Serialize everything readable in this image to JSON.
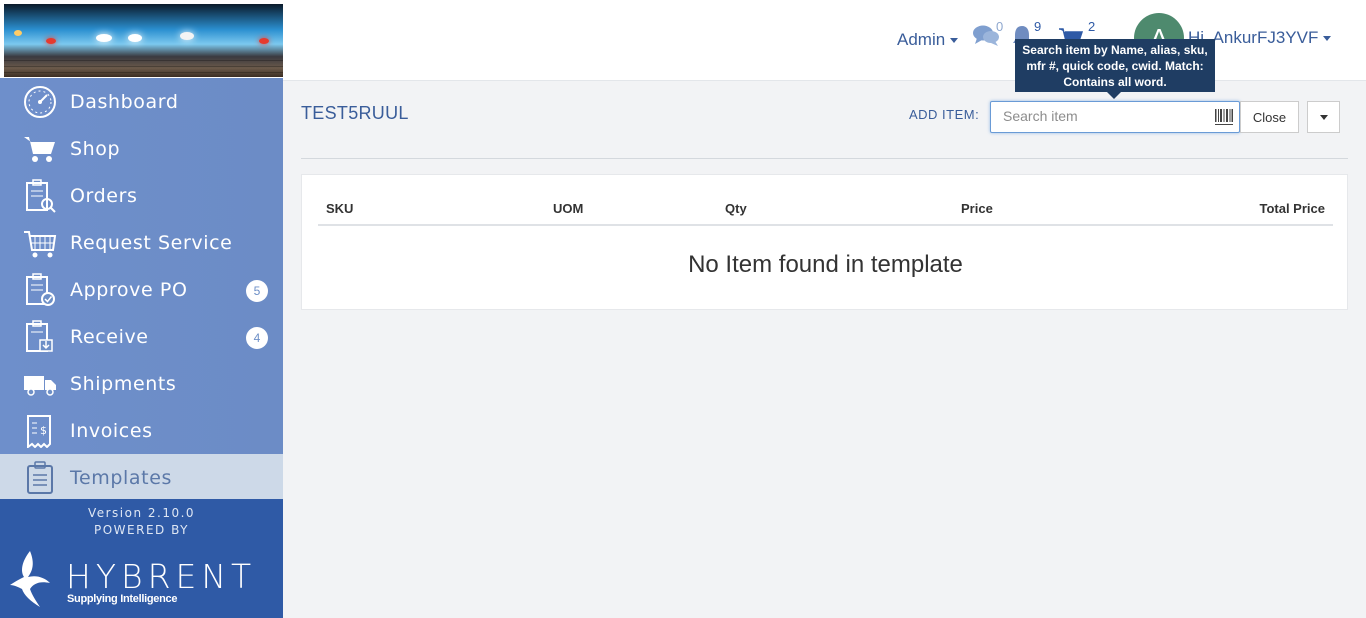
{
  "sidebar": {
    "items": [
      {
        "label": "Dashboard",
        "icon": "dashboard-gauge-icon"
      },
      {
        "label": "Shop",
        "icon": "shopping-cart-icon"
      },
      {
        "label": "Orders",
        "icon": "orders-clipboard-icon"
      },
      {
        "label": "Request Service",
        "icon": "request-service-cart-icon"
      },
      {
        "label": "Approve PO",
        "icon": "approve-clipboard-icon",
        "badge": "5"
      },
      {
        "label": "Receive",
        "icon": "receive-clipboard-icon",
        "badge": "4"
      },
      {
        "label": "Shipments",
        "icon": "truck-icon"
      },
      {
        "label": "Invoices",
        "icon": "invoice-icon"
      },
      {
        "label": "Templates",
        "icon": "template-clipboard-icon",
        "active": true
      }
    ],
    "footer": {
      "version": "Version 2.10.0",
      "powered_by": "POWERED BY",
      "brand": "HYBRENT",
      "tagline": "Supplying Intelligence"
    }
  },
  "header": {
    "admin_label": "Admin",
    "messages_count": "0",
    "notifications_count": "9",
    "cart_count": "2",
    "avatar_initial": "A",
    "user_greeting": "Hi, AnkurFJ3YVF"
  },
  "tooltip": {
    "text": "Search item by Name, alias, sku, mfr #, quick code, cwid. Match: Contains all word."
  },
  "main": {
    "title": "TEST5RUUL",
    "add_item_label": "ADD ITEM:",
    "search_placeholder": "Search item",
    "close_label": "Close",
    "table": {
      "columns": [
        "SKU",
        "UOM",
        "Qty",
        "Price",
        "Total Price"
      ],
      "empty_message": "No Item found in template"
    }
  },
  "colors": {
    "sidebar_bg": "#6d8fc7",
    "sidebar_active": "#cdd9e8",
    "sidebar_footer": "#2f5aa6",
    "accent_text": "#3a5d9a",
    "tooltip_bg": "#1f3d63",
    "avatar_bg": "#4e8a6e"
  }
}
